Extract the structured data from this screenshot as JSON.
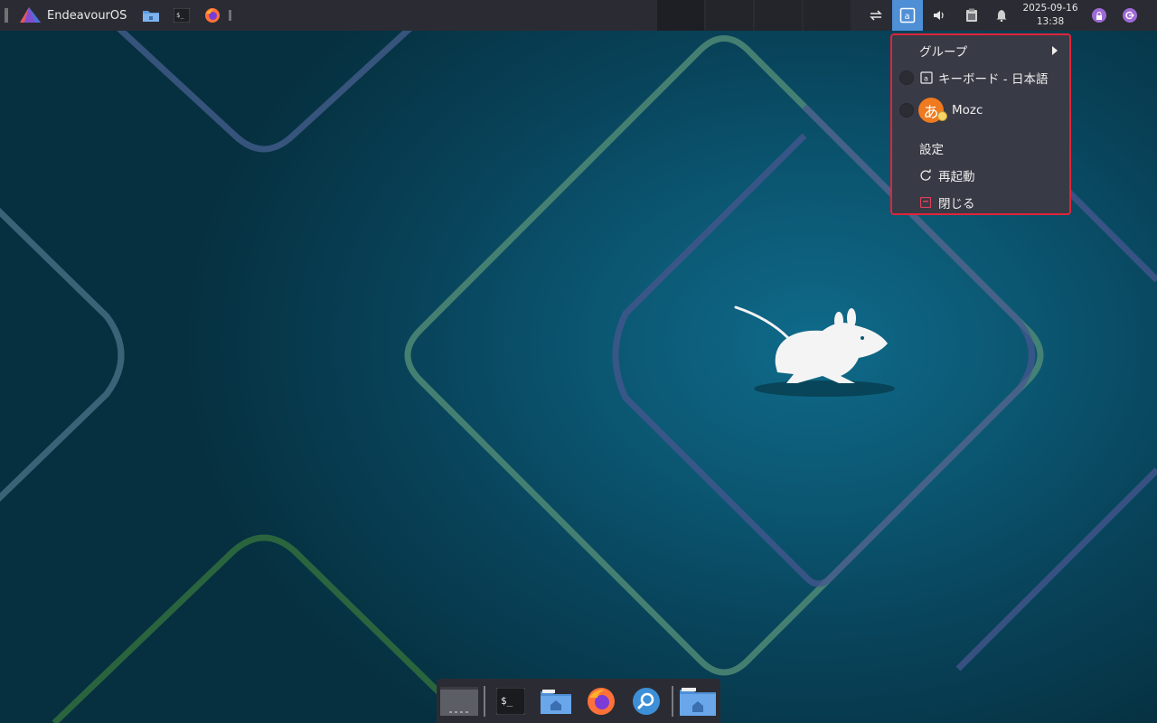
{
  "panel": {
    "menu_label": "EndeavourOS",
    "clock_date": "2025-09-16",
    "clock_time": "13:38"
  },
  "ime_menu": {
    "group_label": "グループ",
    "keyboard_label": "キーボード - 日本語",
    "mozc_label": "Mozc",
    "mozc_glyph": "あ",
    "settings_label": "設定",
    "restart_label": "再起動",
    "close_label": "閉じる"
  },
  "terminal_glyph": "$_",
  "icons": {
    "launchers": [
      "file-manager-icon",
      "terminal-icon",
      "firefox-icon"
    ],
    "tray": [
      "display-icon",
      "input-method-icon",
      "volume-icon",
      "clipboard-icon",
      "notification-icon",
      "lock-icon",
      "logout-icon"
    ],
    "dock": [
      "show-desktop-icon",
      "terminal-icon",
      "home-folder-icon",
      "firefox-icon",
      "search-icon",
      "folder-icon"
    ]
  },
  "colors": {
    "panel": "#2b2c33",
    "accent": "#4f8fd6",
    "highlight_border": "#e0243a",
    "menu_bg": "#383a45",
    "mozc": "#ef7a1f",
    "session": "#9e6ad6"
  }
}
